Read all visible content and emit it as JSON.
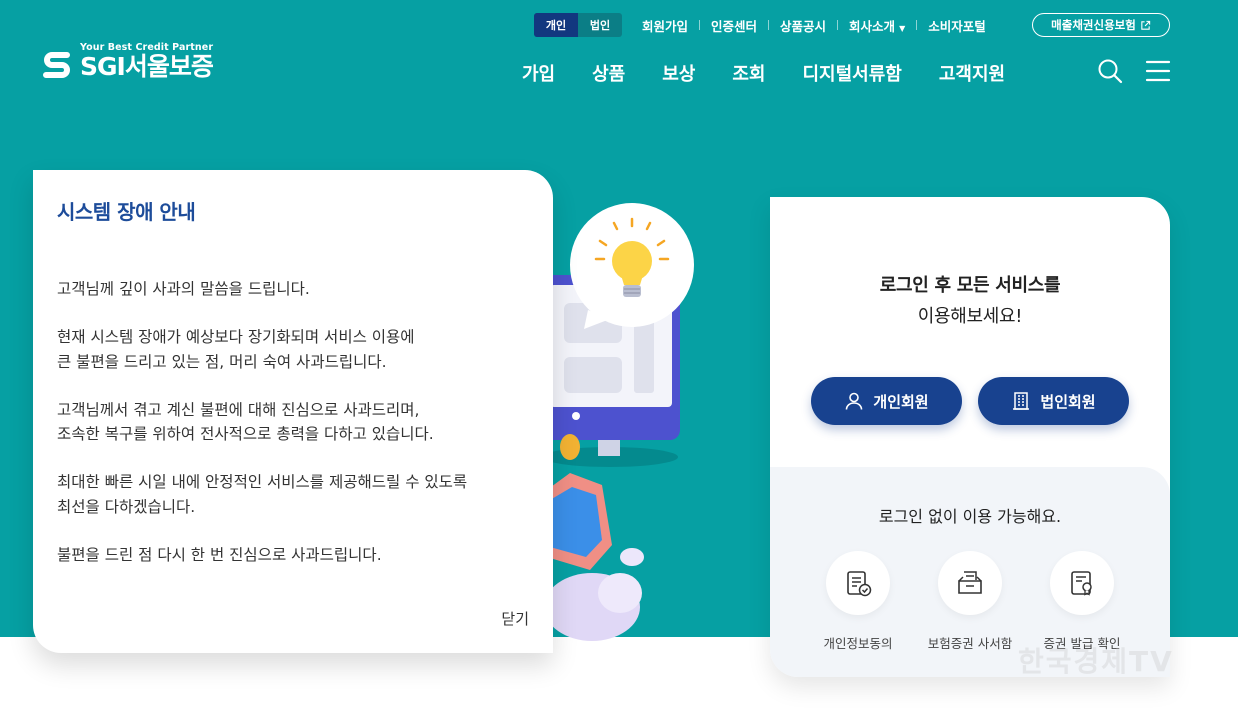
{
  "header": {
    "logo_tagline": "Your Best Credit Partner",
    "logo_name": "SGI서울보증",
    "member_type_toggle": [
      "개인",
      "법인"
    ],
    "utility_links": [
      "회원가입",
      "인증센터",
      "상품공시",
      "회사소개",
      "소비자포털"
    ],
    "external_button": "매출채권신용보험",
    "nav": [
      "가입",
      "상품",
      "보상",
      "조회",
      "디지털서류함",
      "고객지원"
    ]
  },
  "notice": {
    "title": "시스템 장애 안내",
    "paragraphs": [
      "고객님께 깊이 사과의 말씀을 드립니다.",
      "현재 시스템 장애가 예상보다 장기화되며 서비스 이용에\n큰 불편을 드리고 있는 점, 머리 숙여 사과드립니다.",
      "고객님께서 겪고 계신 불편에 대해 진심으로 사과드리며,\n조속한 복구를 위하여 전사적으로 총력을 다하고 있습니다.",
      "최대한 빠른 시일 내에 안정적인 서비스를 제공해드릴 수 있도록\n최선을 다하겠습니다.",
      "불편을 드린 점 다시 한 번 진심으로 사과드립니다."
    ],
    "close_label": "닫기"
  },
  "login": {
    "message_line1": "로그인 후 모든 서비스를",
    "message_line2": "이용해보세요!",
    "personal_button": "개인회원",
    "corporate_button": "법인회원",
    "guest_title": "로그인 없이 이용 가능해요.",
    "quick_items": [
      "개인정보동의",
      "보험증권 사서함",
      "증권 발급 확인"
    ]
  },
  "watermark": "한국경제TV",
  "icons": [
    "search-icon",
    "menu-icon",
    "external-link-icon",
    "person-icon",
    "building-icon",
    "agreement-icon",
    "mailbox-icon",
    "certificate-icon",
    "lightbulb-icon"
  ],
  "colors": {
    "hero": "#06a0a3",
    "primary": "#18428f",
    "title": "#1d4c9a",
    "toggle_active": "#12377f"
  }
}
